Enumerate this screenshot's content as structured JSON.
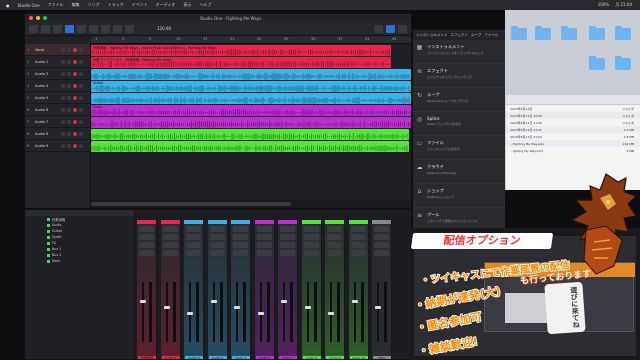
{
  "menubar": {
    "items": [
      "Studio One",
      "ファイル",
      "編集",
      "ソング",
      "トラック",
      "イベント",
      "オーディオ",
      "表示",
      "ヘルプ"
    ],
    "right": [
      "100%",
      "月 21:04"
    ]
  },
  "daw": {
    "title": "Studio One - Fighting Me Ways",
    "toolbar_tempo": "120.00",
    "ruler": [
      "1",
      "5",
      "9",
      "13",
      "17",
      "21",
      "25",
      "29",
      "33",
      "37",
      "41",
      "45"
    ],
    "tracks": [
      {
        "num": "1",
        "name": "Vocal",
        "color": "#e8254b",
        "clip": "作業用唄 - Fighting Me Ways - [Vocal Music Vocal Remix] - Fighting Me Ways"
      },
      {
        "num": "2",
        "name": "Audio 2",
        "color": "#e8254b",
        "clip": "作業ブイアウトスト - 作業用唄 - Fighting Me Ways"
      },
      {
        "num": "3",
        "name": "Audio 3",
        "color": "#3bb2e8",
        "clip": ""
      },
      {
        "num": "4",
        "name": "Audio 4",
        "color": "#3bb2e8",
        "clip": "Guitar"
      },
      {
        "num": "5",
        "name": "Audio 5",
        "color": "#3bb2e8",
        "clip": ""
      },
      {
        "num": "6",
        "name": "Audio 6",
        "color": "#c12bd6",
        "clip": "Synth"
      },
      {
        "num": "7",
        "name": "Audio 7",
        "color": "#c12bd6",
        "clip": ""
      },
      {
        "num": "8",
        "name": "Audio 8",
        "color": "#53e53a",
        "clip": ""
      },
      {
        "num": "9",
        "name": "Audio 9",
        "color": "#53e53a",
        "clip": ""
      }
    ],
    "mixer_list": [
      "作業用唄",
      "Audio",
      "Guitar",
      "Synth",
      "FX",
      "Bus 1",
      "Bus 2",
      "Main"
    ],
    "channels": [
      {
        "color": "#e8254b",
        "label": "作業用唄"
      },
      {
        "color": "#e8254b",
        "label": "Audio 2"
      },
      {
        "color": "#3bb2e8",
        "label": "Audio 3"
      },
      {
        "color": "#3bb2e8",
        "label": "Audio 4"
      },
      {
        "color": "#3bb2e8",
        "label": "Audio 5"
      },
      {
        "color": "#c12bd6",
        "label": "Audio 6"
      },
      {
        "color": "#c12bd6",
        "label": "Audio 7"
      },
      {
        "color": "#53e53a",
        "label": "Audio 8"
      },
      {
        "color": "#53e53a",
        "label": "Audio 9"
      },
      {
        "color": "#53e53a",
        "label": "Audio 10"
      },
      {
        "color": "#888888",
        "label": "Main"
      }
    ]
  },
  "panel": {
    "tabs": [
      "インストゥルメント",
      "エフェクト",
      "ループ",
      "ファイル",
      "クラウド"
    ],
    "items": [
      {
        "icon": "keyboard-icon",
        "glyph": "▦",
        "title": "インストゥルメント",
        "sub": "インストゥルメントをドラッグ&ドロップ"
      },
      {
        "icon": "effect-icon",
        "glyph": "≋",
        "title": "エフェクト",
        "sub": "エフェクトをトラックにドラッグ"
      },
      {
        "icon": "loop-icon",
        "glyph": "↻",
        "title": "ループ",
        "sub": "Studio One ループのブラウズ"
      },
      {
        "icon": "splice-icon",
        "glyph": "◎",
        "title": "Splice",
        "sub": "Splice ライブラリを表示"
      },
      {
        "icon": "file-icon",
        "glyph": "▭",
        "title": "ファイル",
        "sub": "ファイルシステムを表示"
      },
      {
        "icon": "cloud-icon",
        "glyph": "☁",
        "title": "クラウド",
        "sub": "PreSonus Exchange"
      },
      {
        "icon": "shop-icon",
        "glyph": "⌂",
        "title": "ショップ",
        "sub": "PreSonus ショップ"
      },
      {
        "icon": "pool-icon",
        "glyph": "≡",
        "title": "プール",
        "sub": "このソングで使用されているファイル"
      }
    ]
  },
  "finder": {
    "rows": [
      [
        "2023年8月12日",
        "フォルダ"
      ],
      [
        "2023年8月12日 20:55",
        "フォルダ"
      ],
      [
        "2023年8月12日 21:00",
        "フォルダ"
      ],
      [
        "2023年8月12日 21:01",
        "2.3 MB"
      ],
      [
        "2023年8月12日 21:03",
        "1.8 MB"
      ],
      [
        "...Fighting Me Way.wav",
        "262 MB"
      ],
      [
        "...ighting My Way.mp3",
        "4 MB"
      ]
    ]
  },
  "overlay": {
    "title": "配信オプション",
    "bullets": [
      "・ツイキャスにて作業風景の配信",
      "・納期が速発(大)",
      "・匿名参加可",
      "・雑談歓迎!"
    ],
    "note": "も行っております",
    "badge": "遊びに来てね"
  }
}
